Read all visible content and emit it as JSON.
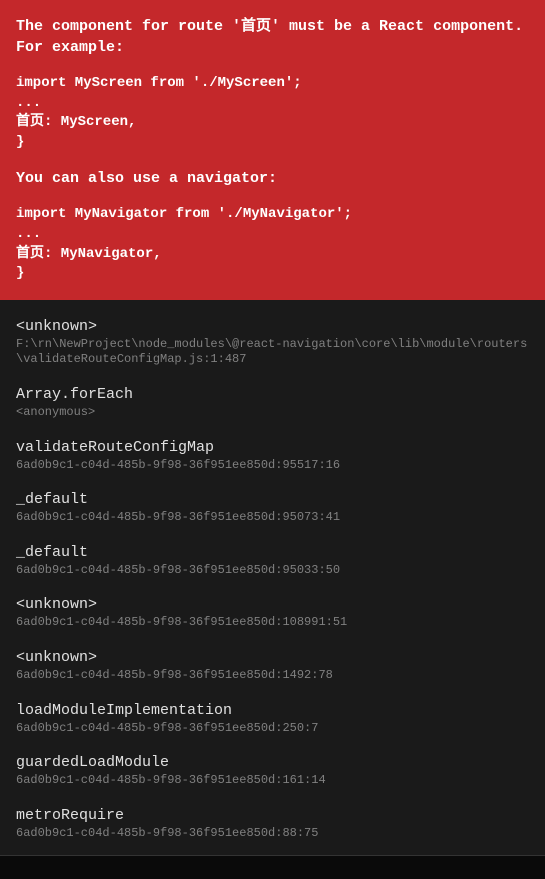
{
  "error": {
    "title": "The component for route '首页' must be a React component. For example:",
    "code_block_1": "import MyScreen from './MyScreen';\n...\n首页: MyScreen,\n}",
    "message_2": "You can also use a navigator:",
    "code_block_2": "import MyNavigator from './MyNavigator';\n...\n首页: MyNavigator,\n}"
  },
  "stack": [
    {
      "method": "<unknown>",
      "location": "F:\\rn\\NewProject\\node_modules\\@react-navigation\\core\\lib\\module\\routers\\validateRouteConfigMap.js:1:487"
    },
    {
      "method": "Array.forEach",
      "location": "<anonymous>"
    },
    {
      "method": "validateRouteConfigMap",
      "location": "6ad0b9c1-c04d-485b-9f98-36f951ee850d:95517:16"
    },
    {
      "method": "_default",
      "location": "6ad0b9c1-c04d-485b-9f98-36f951ee850d:95073:41"
    },
    {
      "method": "_default",
      "location": "6ad0b9c1-c04d-485b-9f98-36f951ee850d:95033:50"
    },
    {
      "method": "<unknown>",
      "location": "6ad0b9c1-c04d-485b-9f98-36f951ee850d:108991:51"
    },
    {
      "method": "<unknown>",
      "location": "6ad0b9c1-c04d-485b-9f98-36f951ee850d:1492:78"
    },
    {
      "method": "loadModuleImplementation",
      "location": "6ad0b9c1-c04d-485b-9f98-36f951ee850d:250:7"
    },
    {
      "method": "guardedLoadModule",
      "location": "6ad0b9c1-c04d-485b-9f98-36f951ee850d:161:14"
    },
    {
      "method": "metroRequire",
      "location": "6ad0b9c1-c04d-485b-9f98-36f951ee850d:88:75"
    }
  ]
}
